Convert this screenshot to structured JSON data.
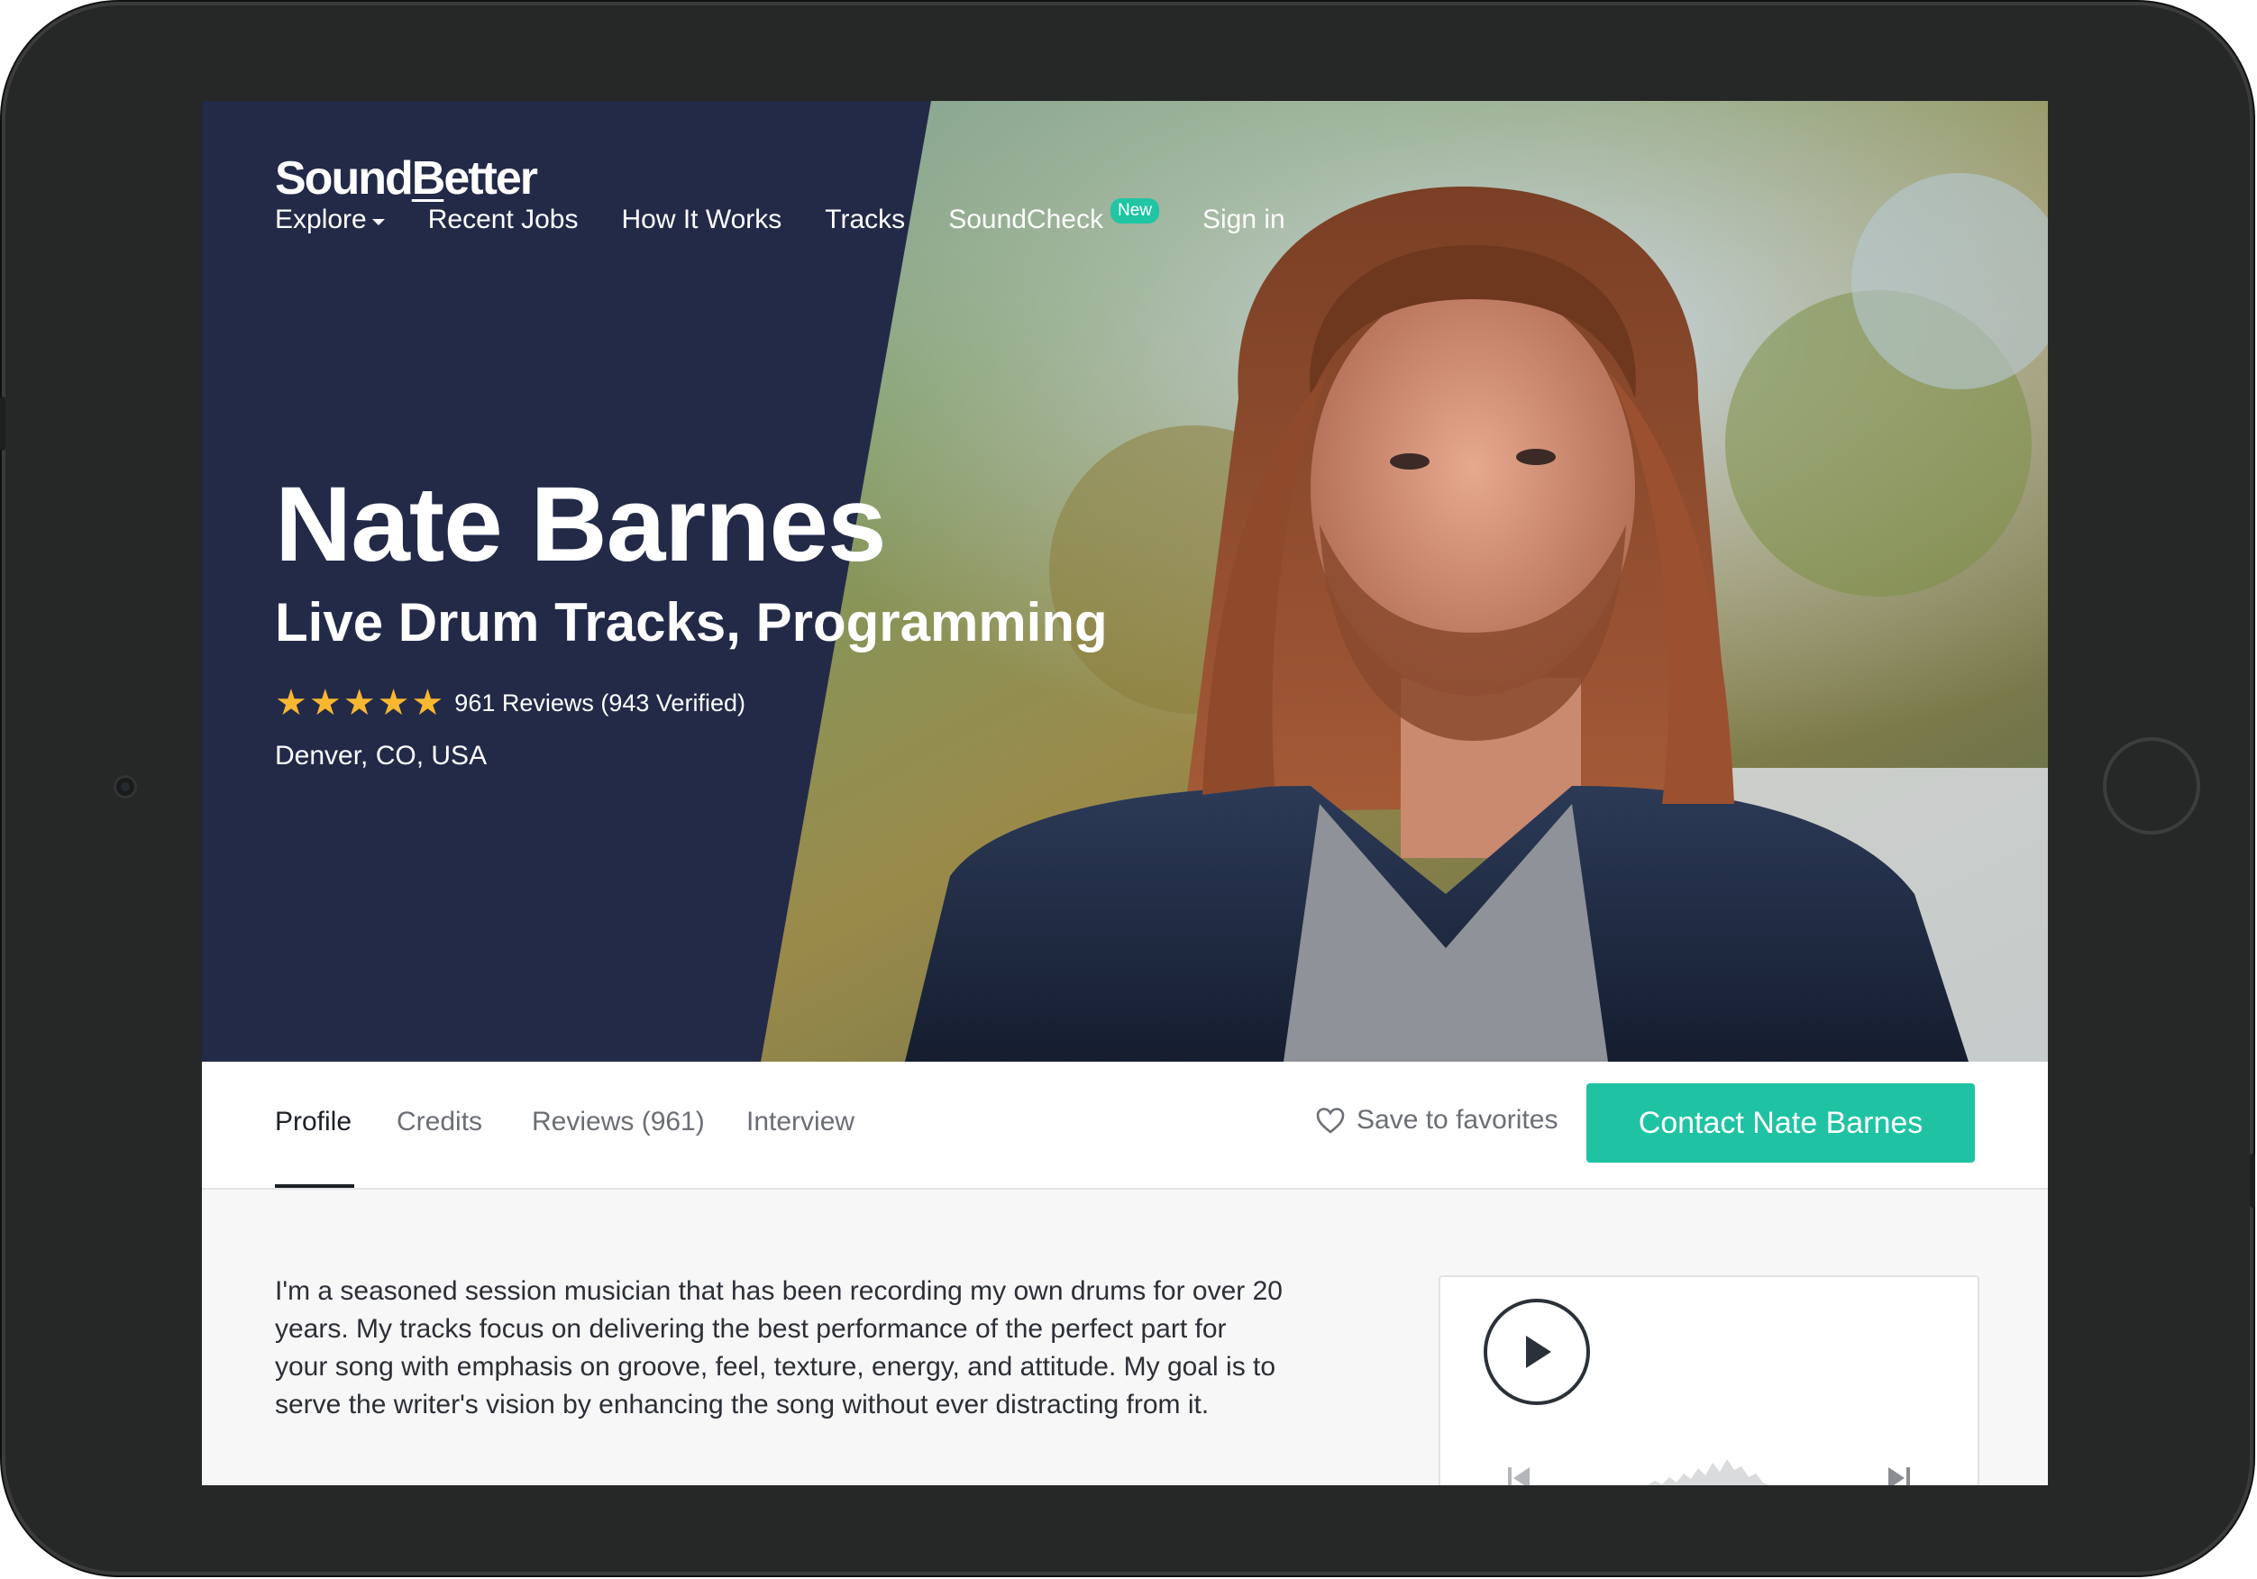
{
  "brand": {
    "logo_left": "Sound",
    "logo_underlined": "B",
    "logo_right": "etter"
  },
  "nav": {
    "explore": "Explore",
    "recent_jobs": "Recent Jobs",
    "how_it_works": "How It Works",
    "tracks": "Tracks",
    "soundcheck": "SoundCheck",
    "soundcheck_badge": "New",
    "sign_in": "Sign in"
  },
  "profile": {
    "name": "Nate Barnes",
    "subtitle": "Live Drum Tracks, Programming",
    "rating_stars": 5,
    "reviews_text": "961 Reviews (943 Verified)",
    "location": "Denver, CO, USA"
  },
  "tabs": {
    "profile": "Profile",
    "credits": "Credits",
    "reviews": "Reviews (961)",
    "interview": "Interview"
  },
  "actions": {
    "save_favorites": "Save to favorites",
    "contact": "Contact Nate Barnes"
  },
  "bio": {
    "text": "I'm a seasoned session musician that has been recording my own drums for over 20 years. My tracks focus on delivering the best performance of the perfect part for your song with emphasis on groove, feel, texture, energy, and attitude. My goal is to serve the writer's vision by enhancing the song without ever distracting from it."
  },
  "colors": {
    "navy": "#232a48",
    "accent": "#1fc3a4",
    "star": "#f7b731",
    "device": "#262727"
  },
  "icons": [
    "heart-icon",
    "play-icon",
    "skip-previous-icon",
    "skip-next-icon",
    "caret-down-icon",
    "star-icon"
  ]
}
